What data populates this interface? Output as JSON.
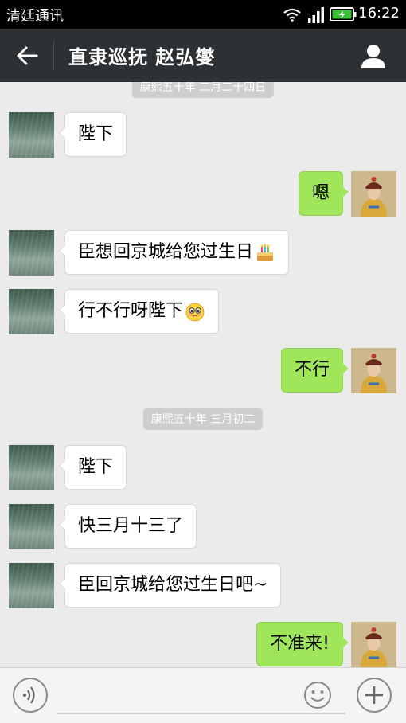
{
  "status_bar": {
    "carrier": "清廷通讯",
    "time": "16:22"
  },
  "header": {
    "title": "直隶巡抚 赵弘燮"
  },
  "timestamps": [
    "康熙五十年 二月二十四日",
    "康熙五十年 三月初二"
  ],
  "messages": [
    {
      "side": "in",
      "text": "陛下"
    },
    {
      "side": "out",
      "text": "嗯"
    },
    {
      "side": "in",
      "text": "臣想回京城给您过生日",
      "emoji": "cake-icon"
    },
    {
      "side": "in",
      "text": "行不行呀陛下",
      "emoji": "pleading-face-icon"
    },
    {
      "side": "out",
      "text": "不行"
    },
    {
      "side": "in",
      "text": "陛下"
    },
    {
      "side": "in",
      "text": "快三月十三了"
    },
    {
      "side": "in",
      "text": "臣回京城给您过生日吧~"
    },
    {
      "side": "out",
      "text": "不准来!"
    }
  ],
  "input": {
    "value": "",
    "placeholder": ""
  },
  "colors": {
    "outgoing_bubble": "#9fe65a",
    "header_bg": "#2d3133",
    "chat_bg": "#ebebeb"
  }
}
